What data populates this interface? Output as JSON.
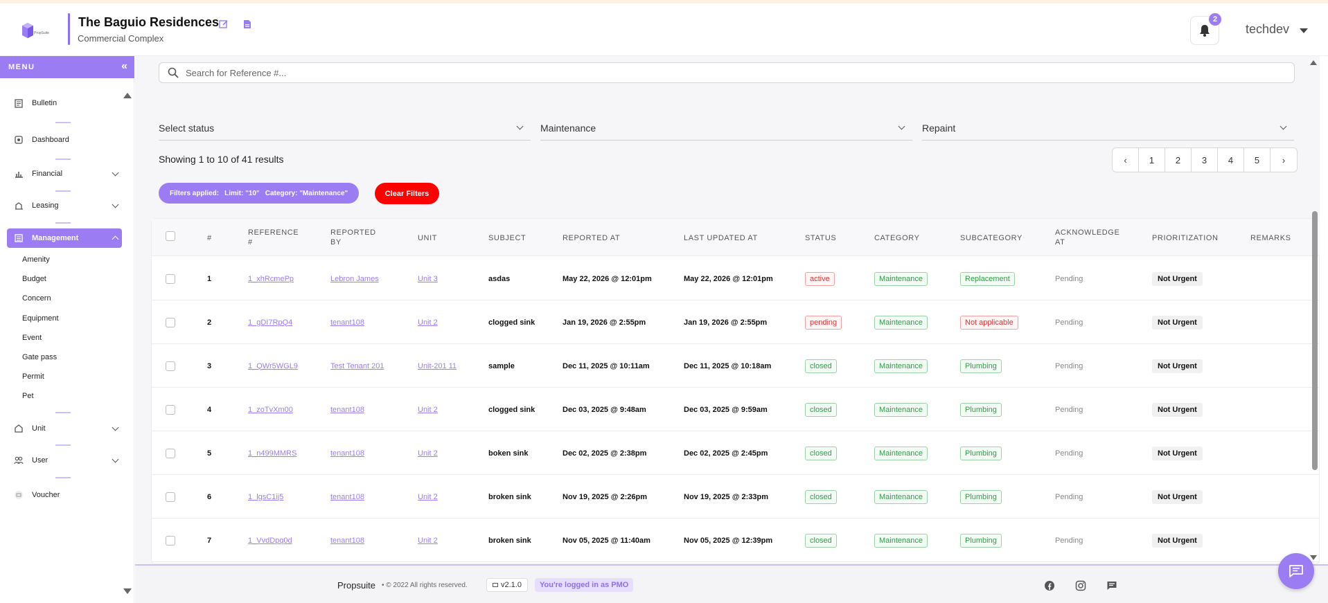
{
  "header": {
    "property_name": "The Baguio Residences",
    "property_type": "Commercial Complex",
    "notification_count": "2",
    "username": "techdev",
    "logo_text": "PropSuite"
  },
  "sidebar": {
    "menu_label": "MENU",
    "items": [
      {
        "label": "Bulletin",
        "icon": "bulletin-icon"
      },
      {
        "label": "Dashboard",
        "icon": "dashboard-icon"
      },
      {
        "label": "Financial",
        "icon": "financial-icon"
      },
      {
        "label": "Leasing",
        "icon": "leasing-icon"
      },
      {
        "label": "Management",
        "icon": "management-icon"
      },
      {
        "label": "Unit",
        "icon": "unit-icon"
      },
      {
        "label": "User",
        "icon": "user-icon"
      },
      {
        "label": "Voucher",
        "icon": "voucher-icon"
      }
    ],
    "management_sub": [
      "Amenity",
      "Budget",
      "Concern",
      "Equipment",
      "Event",
      "Gate pass",
      "Permit",
      "Pet"
    ]
  },
  "search": {
    "placeholder": "Search for Reference #..."
  },
  "filters": {
    "status": "Select status",
    "category": "Maintenance",
    "subcategory": "Repaint",
    "applied_label": "Filters applied:",
    "applied_limit": "Limit: \"10\"",
    "applied_category": "Category: \"Maintenance\"",
    "clear_label": "Clear Filters"
  },
  "results": {
    "showing": "Showing 1 to 10 of 41 results"
  },
  "pagination": {
    "pages": [
      "1",
      "2",
      "3",
      "4",
      "5"
    ]
  },
  "table": {
    "headers": {
      "num": "#",
      "reference": "REFERENCE #",
      "reported_by": "REPORTED BY",
      "unit": "UNIT",
      "subject": "SUBJECT",
      "reported_at": "REPORTED AT",
      "last_updated_at": "LAST UPDATED AT",
      "status": "STATUS",
      "category": "CATEGORY",
      "subcategory": "SUBCATEGORY",
      "acknowledge_at": "ACKNOWLEDGE AT",
      "prioritization": "PRIORITIZATION",
      "remarks": "REMARKS"
    },
    "rows": [
      {
        "num": "1",
        "reference": "1_xhRcmePp",
        "reported_by": "Lebron James",
        "unit": "Unit 3",
        "subject": "asdas",
        "reported_at": "May 22, 2026 @ 12:01pm",
        "last_updated_at": "May 22, 2026 @ 12:01pm",
        "status": "active",
        "category": "Maintenance",
        "subcategory": "Replacement",
        "acknowledge_at": "Pending",
        "prioritization": "Not Urgent"
      },
      {
        "num": "2",
        "reference": "1_gDI7RpQ4",
        "reported_by": "tenant108",
        "unit": "Unit 2",
        "subject": "clogged sink",
        "reported_at": "Jan 19, 2026 @ 2:55pm",
        "last_updated_at": "Jan 19, 2026 @ 2:55pm",
        "status": "pending",
        "category": "Maintenance",
        "subcategory": "Not applicable",
        "acknowledge_at": "Pending",
        "prioritization": "Not Urgent"
      },
      {
        "num": "3",
        "reference": "1_QWr5WGL9",
        "reported_by": "Test Tenant 201",
        "unit": "Unit-201 11",
        "subject": "sample",
        "reported_at": "Dec 11, 2025 @ 10:11am",
        "last_updated_at": "Dec 11, 2025 @ 10:18am",
        "status": "closed",
        "category": "Maintenance",
        "subcategory": "Plumbing",
        "acknowledge_at": "Pending",
        "prioritization": "Not Urgent"
      },
      {
        "num": "4",
        "reference": "1_zoTvXm00",
        "reported_by": "tenant108",
        "unit": "Unit 2",
        "subject": "clogged sink",
        "reported_at": "Dec 03, 2025 @ 9:48am",
        "last_updated_at": "Dec 03, 2025 @ 9:59am",
        "status": "closed",
        "category": "Maintenance",
        "subcategory": "Plumbing",
        "acknowledge_at": "Pending",
        "prioritization": "Not Urgent"
      },
      {
        "num": "5",
        "reference": "1_n499MMRS",
        "reported_by": "tenant108",
        "unit": "Unit 2",
        "subject": "boken sink",
        "reported_at": "Dec 02, 2025 @ 2:38pm",
        "last_updated_at": "Dec 02, 2025 @ 2:45pm",
        "status": "closed",
        "category": "Maintenance",
        "subcategory": "Plumbing",
        "acknowledge_at": "Pending",
        "prioritization": "Not Urgent"
      },
      {
        "num": "6",
        "reference": "1_lgsC1ij5",
        "reported_by": "tenant108",
        "unit": "Unit 2",
        "subject": "broken sink",
        "reported_at": "Nov 19, 2025 @ 2:26pm",
        "last_updated_at": "Nov 19, 2025 @ 2:33pm",
        "status": "closed",
        "category": "Maintenance",
        "subcategory": "Plumbing",
        "acknowledge_at": "Pending",
        "prioritization": "Not Urgent"
      },
      {
        "num": "7",
        "reference": "1_VvdDpq0d",
        "reported_by": "tenant108",
        "unit": "Unit 2",
        "subject": "broken sink",
        "reported_at": "Nov 05, 2025 @ 11:40am",
        "last_updated_at": "Nov 05, 2025 @ 12:39pm",
        "status": "closed",
        "category": "Maintenance",
        "subcategory": "Plumbing",
        "acknowledge_at": "Pending",
        "prioritization": "Not Urgent"
      }
    ]
  },
  "footer": {
    "brand": "Propsuite",
    "copyright": "© 2022 All rights reserved.",
    "version": "v2.1.0",
    "login_status": "You're logged in as PMO"
  },
  "colors": {
    "accent": "#9b7cf2",
    "danger": "#ff0000",
    "success": "#2f9e44"
  }
}
